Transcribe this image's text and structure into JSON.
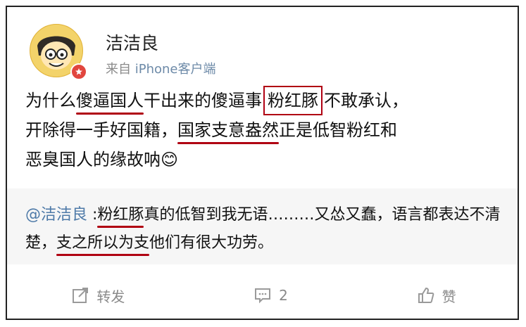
{
  "post": {
    "username": "洁洁良",
    "source_prefix": "来自",
    "source": "iPhone客户端",
    "text": {
      "s1": "为什么",
      "s2": "傻逼国人",
      "s3": "干出来的傻逼事",
      "s4": "粉红豚",
      "s5": "不敢承认，",
      "s6": "开除得一手好国籍，",
      "s7": "国家支意盎然",
      "s8": "正是低智粉红和",
      "s9": "恶臭国人的缘故呐",
      "emoji": "😊"
    }
  },
  "quote": {
    "mention": "@洁洁良",
    "q1": " :",
    "q2": "粉红豚",
    "q3": "真的低智到我无语………又怂又蠢，语言都表达不清楚，",
    "q4": "支之所以为支",
    "q5": "他们有很大功劳。"
  },
  "actions": {
    "share_label": "转发",
    "comment_count": "2",
    "like_label": "赞"
  },
  "colors": {
    "underline": "#b00012",
    "mention": "#4e7aa8",
    "badge": "#e1463e"
  }
}
